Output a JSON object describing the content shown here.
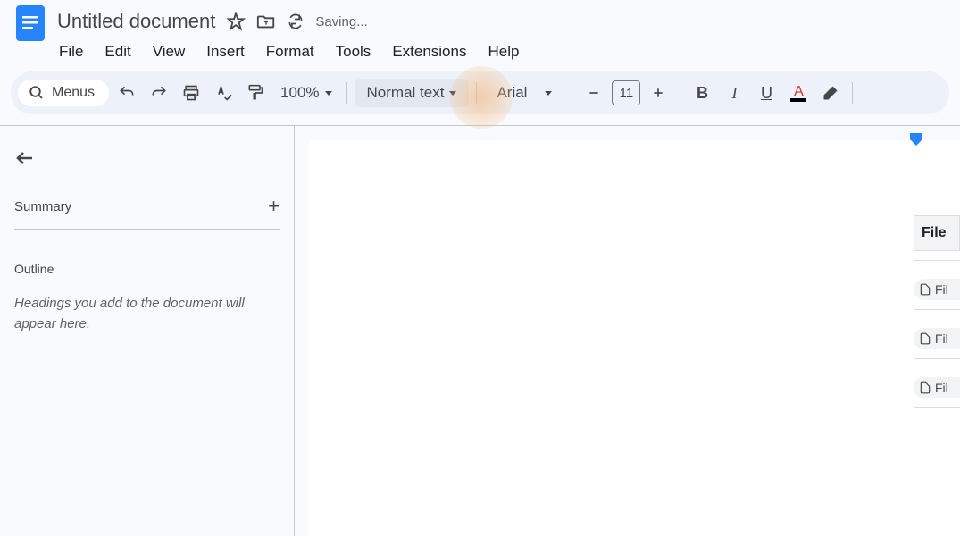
{
  "header": {
    "title": "Untitled document",
    "saving_status": "Saving..."
  },
  "menus": {
    "file": "File",
    "edit": "Edit",
    "view": "View",
    "insert": "Insert",
    "format": "Format",
    "tools": "Tools",
    "extensions": "Extensions",
    "help": "Help"
  },
  "toolbar": {
    "search_label": "Menus",
    "zoom": "100%",
    "style": "Normal text",
    "font": "Arial",
    "font_size": "11"
  },
  "sidebar": {
    "summary_label": "Summary",
    "outline_label": "Outline",
    "outline_hint": "Headings you add to the document will appear here."
  },
  "right_panel": {
    "header": "File",
    "items": [
      "Fil",
      "Fil",
      "Fil"
    ]
  }
}
